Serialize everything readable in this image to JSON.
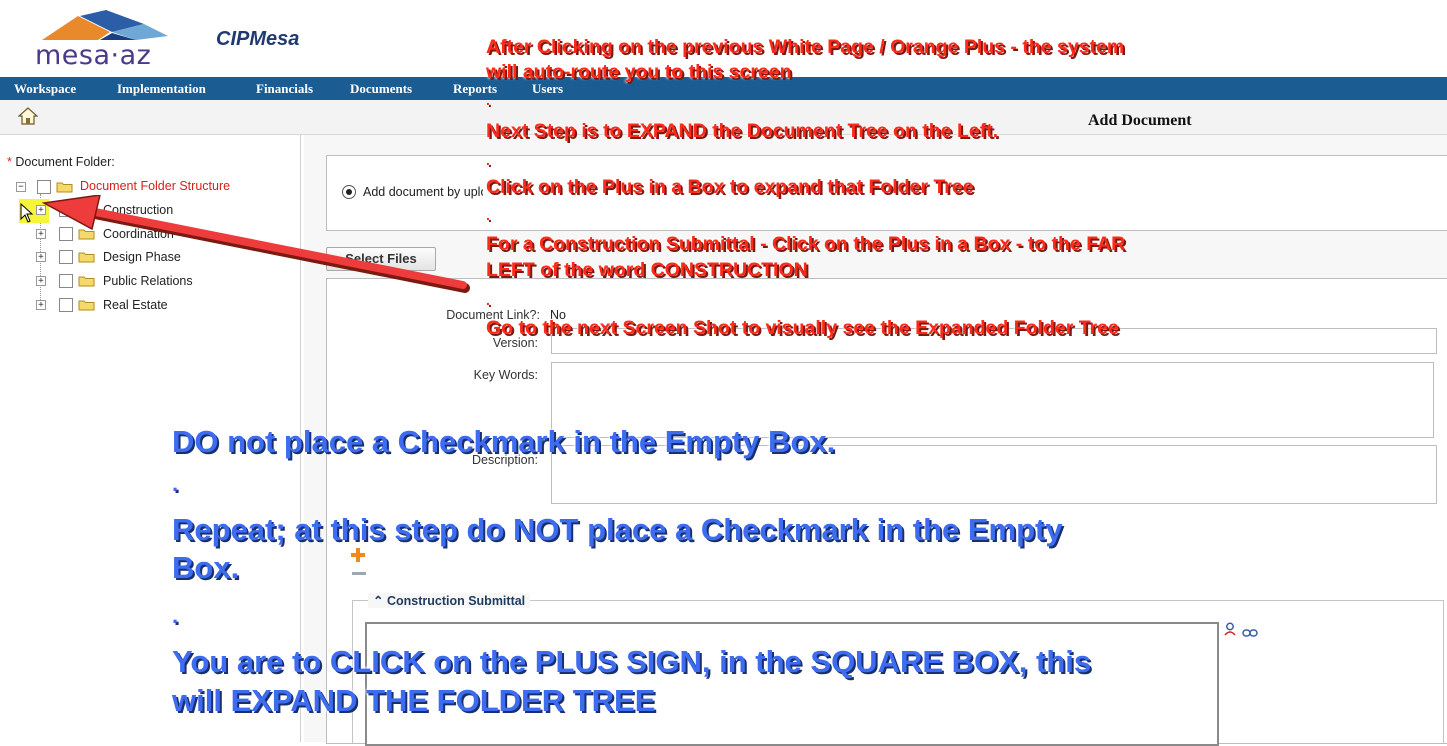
{
  "brand": {
    "logo_text": "mesa·az",
    "app_title": "CIPMesa",
    "logo_colors": [
      "#e88a2c",
      "#2c5ea8",
      "#6fa8d6",
      "#1c3f82"
    ]
  },
  "nav": {
    "items": [
      "Workspace",
      "Implementation",
      "Financials",
      "Documents",
      "Reports",
      "Users"
    ],
    "bar_color": "#1b5c93"
  },
  "toolbar": {
    "home_icon": "home-icon",
    "page_heading": "Add Document"
  },
  "tree": {
    "label": "Document Folder:",
    "required_mark": "*",
    "root": "Document Folder Structure",
    "items": [
      "Construction",
      "Coordination",
      "Design Phase",
      "Public Relations",
      "Real Estate"
    ]
  },
  "form": {
    "radio_label": "Add document by upload",
    "select_files_label": "Select Files",
    "document_link_label": "Document Link?:",
    "document_link_value": "No",
    "version_label": "Version:",
    "keywords_label": "Key Words:",
    "description_label": "Description:",
    "section_title": "Construction Submittal"
  },
  "annotations": {
    "red": [
      "After Clicking on  the previous White Page / Orange Plus - the system",
      "will auto-route you to this screen",
      ".",
      "Next Step is to EXPAND  the Document Tree on the Left.",
      ".",
      "Click on the Plus in a Box to expand that Folder Tree",
      ".",
      "For a Construction Submittal - Click on the Plus in a Box - to the FAR",
      "LEFT of the word CONSTRUCTION",
      ".",
      "Go to the next Screen Shot to visually see the Expanded Folder Tree"
    ],
    "blue": [
      "DO not place a Checkmark in the Empty Box.",
      ".",
      "Repeat; at this step do NOT place a Checkmark in the Empty",
      "Box.",
      ".",
      "You are to CLICK on the PLUS SIGN, in the SQUARE BOX, this",
      "will EXPAND THE FOLDER TREE"
    ],
    "arrow_color": "#ee3b3b",
    "highlight_color": "#f5f53a"
  }
}
